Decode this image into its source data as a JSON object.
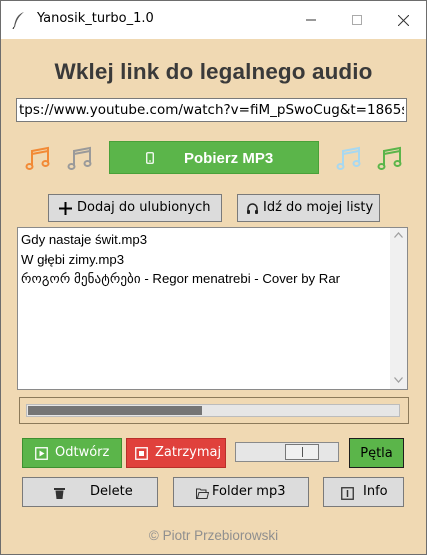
{
  "window": {
    "title": "Yanosik_turbo_1.0"
  },
  "main": {
    "heading": "Wklej link do legalnego audio",
    "url_value": "tps://www.youtube.com/watch?v=fiM_pSwoCug&t=1865s",
    "download_label": "Pobierz MP3",
    "add_favorites_label": "Dodaj do ulubionych",
    "go_to_list_label": "Idź do mojej listy",
    "note_colors": [
      "#f28a36",
      "#9a9a9a",
      "#a8d8f0",
      "#5bb54a"
    ]
  },
  "playlist": {
    "items": [
      "Gdy nastaje świt.mp3",
      "W głębi zimy.mp3",
      "როგორ მენატრები - Regor menatrebi - Cover by Rar"
    ]
  },
  "player": {
    "progress_fraction": 0.47,
    "play_label": "Odtwórz",
    "stop_label": "Zatrzymaj",
    "volume_fraction": 0.72,
    "loop_label": "Pętla"
  },
  "bottom": {
    "delete_label": "Delete",
    "folder_label": "Folder mp3",
    "info_label": "Info"
  },
  "footer": {
    "text": "© Piotr Przebiorowski"
  },
  "colors": {
    "background": "#f0d9b3",
    "green": "#5bb54a",
    "red": "#e0413c",
    "button_gray": "#dcdcdc"
  }
}
